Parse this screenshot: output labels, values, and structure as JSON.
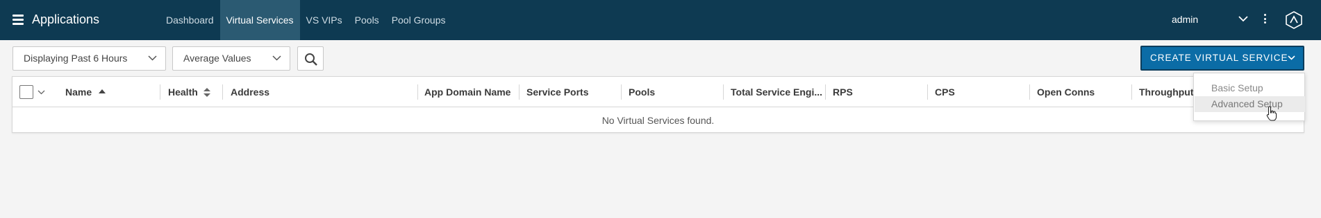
{
  "topbar": {
    "title": "Applications",
    "nav": [
      {
        "label": "Dashboard"
      },
      {
        "label": "Virtual Services"
      },
      {
        "label": "VS VIPs"
      },
      {
        "label": "Pools"
      },
      {
        "label": "Pool Groups"
      }
    ],
    "active_nav": "Virtual Services",
    "user": "admin"
  },
  "toolbar": {
    "time_range": "Displaying Past 6 Hours",
    "metric_mode": "Average Values",
    "create_button": "CREATE VIRTUAL SERVICE"
  },
  "table": {
    "columns": [
      {
        "label": "Name",
        "sort": "ascending"
      },
      {
        "label": "Health",
        "sort": "sortable"
      },
      {
        "label": "Address"
      },
      {
        "label": "App Domain Name"
      },
      {
        "label": "Service Ports"
      },
      {
        "label": "Pools"
      },
      {
        "label": "Total Service Engi..."
      },
      {
        "label": "RPS"
      },
      {
        "label": "CPS"
      },
      {
        "label": "Open Conns"
      },
      {
        "label": "Throughput"
      }
    ],
    "empty_message": "No Virtual Services found."
  },
  "create_menu": {
    "items": [
      {
        "label": "Basic Setup"
      },
      {
        "label": "Advanced Setup"
      }
    ],
    "hovered": "Advanced Setup"
  },
  "colors": {
    "header_bg": "#0e3a52",
    "active_nav_bg": "#2b5a72",
    "primary_button": "#0b6ca6"
  },
  "icons": [
    "menu-icon",
    "chevron-down-icon",
    "kebab-menu-icon",
    "app-logo-icon",
    "search-icon",
    "sort-asc-icon",
    "sort-icon",
    "hand-pointer-cursor"
  ]
}
